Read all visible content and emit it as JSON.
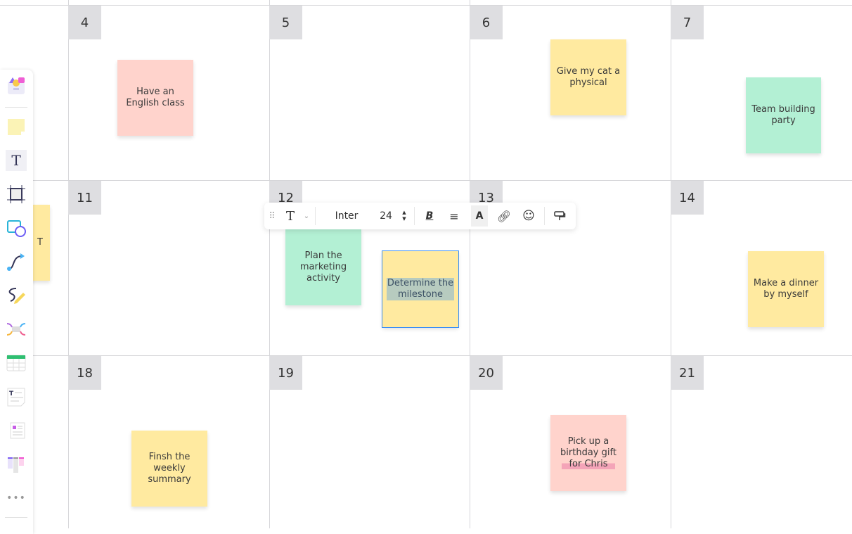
{
  "calendar": {
    "days": [
      "4",
      "5",
      "6",
      "7",
      "11",
      "12",
      "13",
      "14",
      "18",
      "19",
      "20",
      "21"
    ]
  },
  "notes": [
    {
      "text": "Have an English class",
      "color": "pink"
    },
    {
      "text": "Give my cat a physical",
      "color": "yellow"
    },
    {
      "text": "Team building party",
      "color": "green"
    },
    {
      "text": "T",
      "color": "yellow"
    },
    {
      "text": "Plan the marketing activity",
      "color": "green"
    },
    {
      "text": "Determine the milestone",
      "color": "yellow",
      "selected": true
    },
    {
      "text": "Make a dinner by myself",
      "color": "yellow"
    },
    {
      "text": "Finsh the weekly summary",
      "color": "yellow"
    },
    {
      "text": "Pick up a birthday gift",
      "text2": "for Chris",
      "color": "pink"
    }
  ],
  "text_toolbar": {
    "font": "Inter",
    "size": "24",
    "icons": [
      "drag-handle",
      "text-type",
      "chevron-down",
      "bold",
      "align-center",
      "text-color",
      "link",
      "emoji",
      "format-painter"
    ]
  },
  "sidebar": {
    "tools": [
      "templates",
      "sticky-note",
      "text",
      "frame",
      "shapes",
      "connector",
      "pen",
      "mindmap",
      "table",
      "document",
      "card",
      "kanban",
      "more"
    ]
  },
  "colors": {
    "yellow": "#ffeaa0",
    "pink": "#ffd3cc",
    "green": "#b3f0d4",
    "selection": "#3a8ef6"
  }
}
